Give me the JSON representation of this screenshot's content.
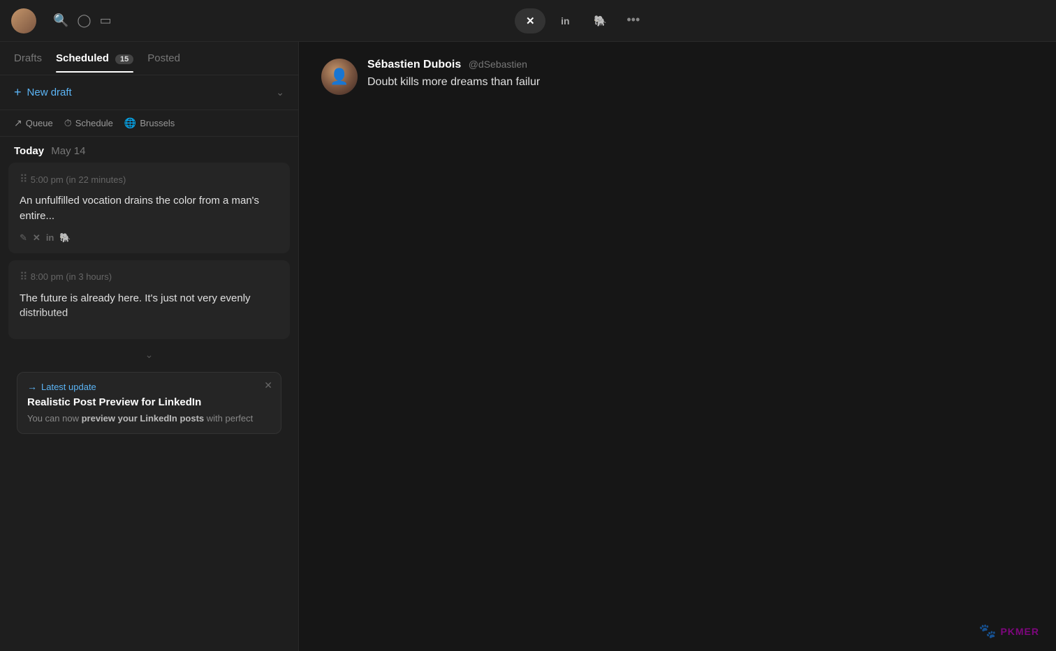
{
  "topbar": {
    "platform_tabs": [
      {
        "id": "x",
        "label": "𝕏",
        "active": true
      },
      {
        "id": "linkedin",
        "label": "in",
        "active": false
      },
      {
        "id": "mastodon",
        "label": "M",
        "active": false
      }
    ],
    "more_label": "•••"
  },
  "sidebar": {
    "tabs": [
      {
        "id": "drafts",
        "label": "Drafts",
        "active": false,
        "badge": null
      },
      {
        "id": "scheduled",
        "label": "Scheduled",
        "active": true,
        "badge": "15"
      },
      {
        "id": "posted",
        "label": "Posted",
        "active": false,
        "badge": null
      }
    ],
    "new_draft_label": "New draft",
    "queue_controls": [
      {
        "id": "queue",
        "label": "Queue",
        "icon": "↗"
      },
      {
        "id": "schedule",
        "label": "Schedule",
        "icon": "🕐"
      },
      {
        "id": "brussels",
        "label": "Brussels",
        "icon": "🌐"
      }
    ],
    "date_header": {
      "today": "Today",
      "date": "May 14"
    },
    "posts": [
      {
        "id": "post1",
        "time": "5:00 pm (in 22 minutes)",
        "text": "An unfulfilled vocation drains the color from a man's entire...",
        "platforms": [
          "thread",
          "x",
          "linkedin",
          "mastodon"
        ],
        "collapsed": false
      },
      {
        "id": "post2",
        "time": "8:00 pm (in 3 hours)",
        "text": "The future is already here. It's just not very evenly distributed",
        "platforms": [],
        "collapsed": true
      }
    ],
    "update_banner": {
      "arrow": "→",
      "label": "Latest update",
      "title": "Realistic Post Preview for LinkedIn",
      "body_plain": "You can now ",
      "body_bold": "preview your LinkedIn posts",
      "body_plain2": " with perfect"
    }
  },
  "preview": {
    "name": "Sébastien Dubois",
    "handle": "@dSebastien",
    "text": "Doubt kills more dreams than failur"
  },
  "watermark": {
    "icon": "🐾",
    "text": "PKMER"
  }
}
